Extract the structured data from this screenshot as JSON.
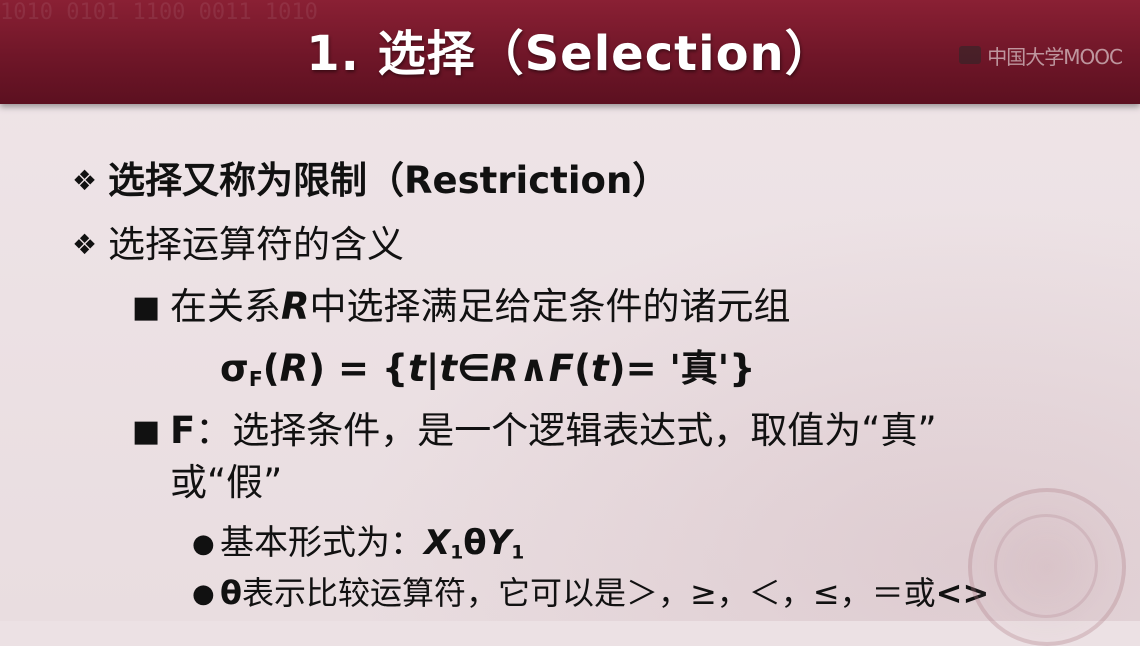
{
  "header": {
    "title": "1. 选择（Selection）",
    "logo_text": "中国大学MOOC",
    "texture": "1010 0101 1100 0011 1010"
  },
  "bullets": {
    "b1": {
      "text": "选择又称为限制（Restriction）"
    },
    "b2": {
      "text": "选择运算符的含义"
    },
    "s1": {
      "pre": "在关系",
      "rel": "R",
      "post": "中选择满足给定条件的诸元组"
    },
    "formula": {
      "sigma": "σ",
      "sub": "F",
      "lp": "(",
      "R1": "R",
      "mid": ") = {",
      "t1": "t",
      "bar": "|",
      "t2": "t",
      "in": "∈",
      "R2": "R",
      "and": "∧",
      "F": "F",
      "lp2": "(",
      "t3": "t",
      "end": ")= '真'}"
    },
    "s2": {
      "label": "F",
      "line1": "：选择条件，是一个逻辑表达式，取值为“真”",
      "line2": "或“假”"
    },
    "d1": {
      "text": "基本形式为：",
      "x": "X",
      "x_sub": "1",
      "theta": "θ",
      "y": "Y",
      "y_sub": "1"
    },
    "d2": {
      "theta": "θ",
      "text": "表示比较运算符，它可以是＞，≥，＜，≤，＝或",
      "ne": "<>"
    }
  },
  "glyphs": {
    "diamond": "❖",
    "square": "■",
    "dot": "●"
  },
  "colors": {
    "header": "#6f1628",
    "background": "#ece1e4",
    "text": "#111111"
  }
}
